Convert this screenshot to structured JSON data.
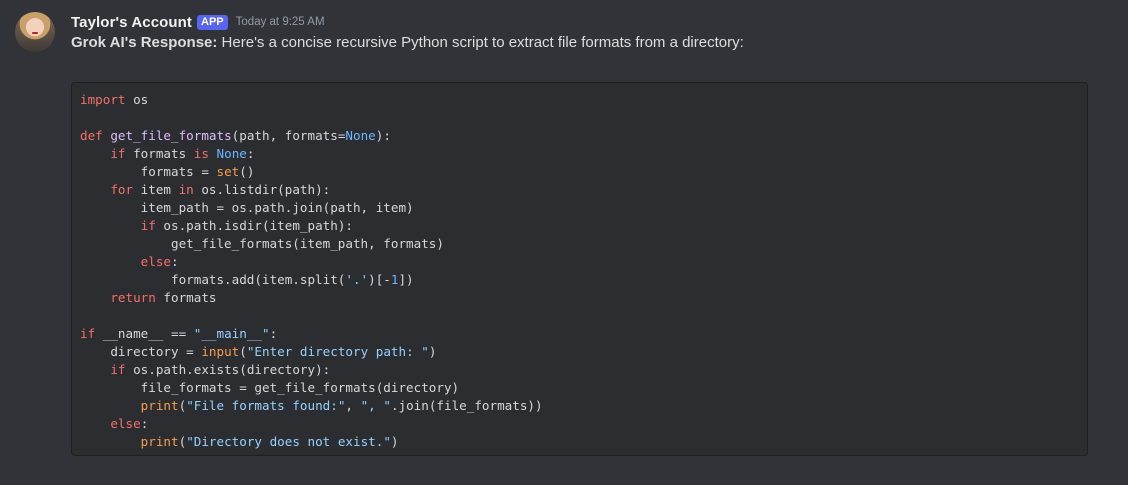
{
  "author": {
    "name": "Taylor's Account",
    "badge": "APP",
    "timestamp": "Today at 9:25 AM"
  },
  "message": {
    "bold_prefix": "Grok AI's Response:",
    "text": " Here's a concise recursive Python script to extract file formats from a directory:"
  },
  "code_block": {
    "language": "python",
    "lines": [
      [
        {
          "t": "import",
          "c": "kw"
        },
        {
          "t": " os"
        }
      ],
      [],
      [
        {
          "t": "def",
          "c": "kw"
        },
        {
          "t": " "
        },
        {
          "t": "get_file_formats",
          "c": "fn"
        },
        {
          "t": "(path, formats="
        },
        {
          "t": "None",
          "c": "cn"
        },
        {
          "t": "):"
        }
      ],
      [
        {
          "t": "    "
        },
        {
          "t": "if",
          "c": "kw"
        },
        {
          "t": " formats "
        },
        {
          "t": "is",
          "c": "kw"
        },
        {
          "t": " "
        },
        {
          "t": "None",
          "c": "cn"
        },
        {
          "t": ":"
        }
      ],
      [
        {
          "t": "        formats = "
        },
        {
          "t": "set",
          "c": "bi"
        },
        {
          "t": "()"
        }
      ],
      [
        {
          "t": "    "
        },
        {
          "t": "for",
          "c": "kw"
        },
        {
          "t": " item "
        },
        {
          "t": "in",
          "c": "kw"
        },
        {
          "t": " os.listdir(path):"
        }
      ],
      [
        {
          "t": "        item_path = os.path.join(path, item)"
        }
      ],
      [
        {
          "t": "        "
        },
        {
          "t": "if",
          "c": "kw"
        },
        {
          "t": " os.path.isdir(item_path):"
        }
      ],
      [
        {
          "t": "            get_file_formats(item_path, formats)"
        }
      ],
      [
        {
          "t": "        "
        },
        {
          "t": "else",
          "c": "kw"
        },
        {
          "t": ":"
        }
      ],
      [
        {
          "t": "            formats.add(item.split("
        },
        {
          "t": "'.'",
          "c": "st"
        },
        {
          "t": ")[-"
        },
        {
          "t": "1",
          "c": "cn"
        },
        {
          "t": "])"
        }
      ],
      [
        {
          "t": "    "
        },
        {
          "t": "return",
          "c": "kw"
        },
        {
          "t": " formats"
        }
      ],
      [],
      [
        {
          "t": "if",
          "c": "kw"
        },
        {
          "t": " __name__ == "
        },
        {
          "t": "\"__main__\"",
          "c": "st"
        },
        {
          "t": ":"
        }
      ],
      [
        {
          "t": "    directory = "
        },
        {
          "t": "input",
          "c": "bi"
        },
        {
          "t": "("
        },
        {
          "t": "\"Enter directory path: \"",
          "c": "st"
        },
        {
          "t": ")"
        }
      ],
      [
        {
          "t": "    "
        },
        {
          "t": "if",
          "c": "kw"
        },
        {
          "t": " os.path.exists(directory):"
        }
      ],
      [
        {
          "t": "        file_formats = get_file_formats(directory)"
        }
      ],
      [
        {
          "t": "        "
        },
        {
          "t": "print",
          "c": "bi"
        },
        {
          "t": "("
        },
        {
          "t": "\"File formats found:\"",
          "c": "st"
        },
        {
          "t": ", "
        },
        {
          "t": "\", \"",
          "c": "st"
        },
        {
          "t": ".join(file_formats))"
        }
      ],
      [
        {
          "t": "    "
        },
        {
          "t": "else",
          "c": "kw"
        },
        {
          "t": ":"
        }
      ],
      [
        {
          "t": "        "
        },
        {
          "t": "print",
          "c": "bi"
        },
        {
          "t": "("
        },
        {
          "t": "\"Directory does not exist.\"",
          "c": "st"
        },
        {
          "t": ")"
        }
      ]
    ]
  },
  "colors": {
    "background": "#313338",
    "code_background": "#2b2d31",
    "badge": "#5865f2",
    "keyword": "#f47067",
    "function": "#dcbdfb",
    "builtin": "#f69d50",
    "string": "#96d0ff",
    "constant": "#6cb6ff"
  }
}
